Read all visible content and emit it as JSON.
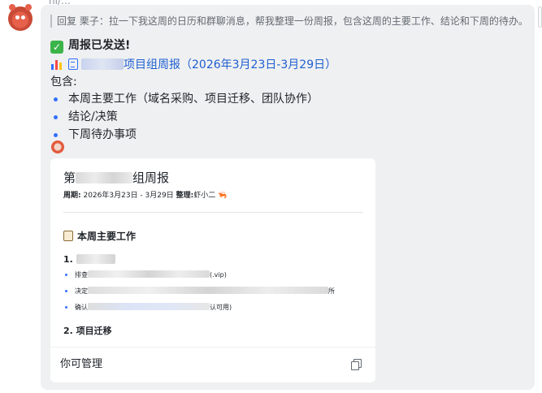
{
  "top_cut_text": "hi/…",
  "message": {
    "reply_quote": "回复 栗子：拉一下我这周的日历和群聊消息，帮我整理一份周报，包含这周的主要工作、结论和下周的待办。",
    "sent_status": "周报已发送!",
    "doc_link_text": "项目组周报（2026年3月23日-3月29日）",
    "contains_label": "包含:",
    "items": [
      "本周主要工作（域名采购、项目迁移、团队协作）",
      "结论/决策",
      "下周待办事项"
    ]
  },
  "card": {
    "title_prefix": "第",
    "title_suffix": "组周报",
    "period_label": "周期:",
    "period_value": "2026年3月23日 - 3月29日",
    "author_label": "整理:",
    "author_value": "虾小二",
    "section_title": "本周主要工作",
    "sub1_prefix": "1.",
    "bullets": [
      {
        "prefix": "排查",
        "suffix": "(.vip)"
      },
      {
        "prefix": "决定",
        "suffix": "所"
      },
      {
        "prefix": "确认",
        "suffix": "认可用)"
      }
    ],
    "sub2": "2. 项目迁移",
    "footer_label": "你可管理"
  },
  "colors": {
    "link": "#1f5fd1",
    "bullet": "#3370ff",
    "bubble_bg": "#eff0f1",
    "check": "#3bb44a"
  },
  "icons": [
    "check-icon",
    "bar-chart-icon",
    "doc-icon",
    "crab-icon",
    "clipboard-icon",
    "copy-icon"
  ]
}
